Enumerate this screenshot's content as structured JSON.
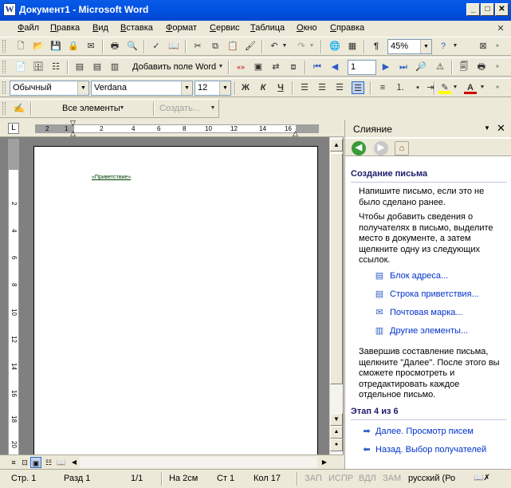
{
  "window": {
    "title": "Документ1 - Microsoft Word",
    "app_icon": "W"
  },
  "menu": [
    "Файл",
    "Правка",
    "Вид",
    "Вставка",
    "Формат",
    "Сервис",
    "Таблица",
    "Окно",
    "Справка"
  ],
  "toolbar_standard": {
    "zoom": "45%"
  },
  "toolbar_mailmerge": {
    "insert_field": "Добавить поле Word",
    "record": "1"
  },
  "toolbar_formatting": {
    "style": "Обычный",
    "font": "Verdana",
    "size": "12",
    "bold": "Ж",
    "italic": "К",
    "underline": "Ч"
  },
  "toolbar_reviewing": {
    "all_elements": "Все элементы",
    "create": "Создать..."
  },
  "ruler": {
    "h_labels": [
      "2",
      "1",
      "2",
      "4",
      "6",
      "8",
      "10",
      "12",
      "14",
      "16"
    ],
    "v_labels": [
      "2",
      "4",
      "6",
      "8",
      "10",
      "12",
      "14",
      "16",
      "18",
      "20"
    ]
  },
  "document": {
    "merge_field": "«Приветствие»"
  },
  "taskpane": {
    "title": "Слияние",
    "section_title": "Создание письма",
    "intro": "Напишите письмо, если это не было сделано ранее.",
    "instructions": "Чтобы добавить сведения о получателях в письмо, выделите место в документе, а затем щелкните одну из следующих ссылок.",
    "links": [
      "Блок адреса...",
      "Строка приветствия...",
      "Почтовая марка...",
      "Другие элементы..."
    ],
    "after_text": "Завершив составление письма, щелкните \"Далее\". После этого вы сможете просмотреть и отредактировать каждое отдельное письмо.",
    "step_title": "Этап 4 из 6",
    "next_link": "Далее. Просмотр писем",
    "back_link": "Назад. Выбор получателей"
  },
  "status": {
    "page": "Стр. 1",
    "section": "Разд 1",
    "pages": "1/1",
    "at": "На 2см",
    "line": "Ст 1",
    "col": "Кол 17",
    "rec": "ЗАП",
    "trk": "ИСПР",
    "ext": "ВДЛ",
    "ovr": "ЗАМ",
    "lang": "русский (Ро"
  }
}
